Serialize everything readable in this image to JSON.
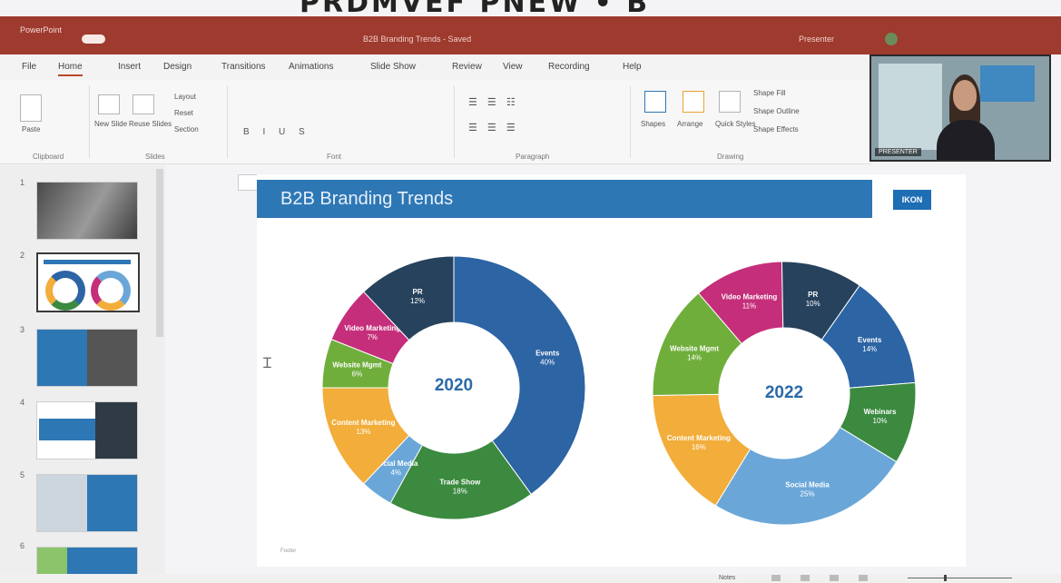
{
  "banner": {
    "text": "PRDMVEF PNEW • B"
  },
  "titlebar": {
    "app_name": "PowerPoint",
    "doc_title": "B2B Branding Trends - Saved",
    "user": "Presenter"
  },
  "menu": [
    "File",
    "Home",
    "Insert",
    "Design",
    "Transitions",
    "Animations",
    "Slide Show",
    "Review",
    "View",
    "Recording",
    "Help"
  ],
  "ribbon": {
    "paste": "Paste",
    "new_slide": "New Slide",
    "reuse": "Reuse Slides",
    "layout": "Layout",
    "reset": "Reset",
    "section": "Section",
    "shapes": "Shapes",
    "arrange": "Arrange",
    "quick_styles": "Quick Styles",
    "shape_fill": "Shape Fill",
    "shape_outline": "Shape Outline",
    "shape_effects": "Shape Effects",
    "groups": [
      "Clipboard",
      "Slides",
      "Font",
      "Paragraph",
      "Drawing"
    ]
  },
  "webcam": {
    "name": "PRESENTER"
  },
  "thumbnails": [
    "1",
    "2",
    "3",
    "4",
    "5",
    "6"
  ],
  "slide": {
    "title": "B2B Branding Trends",
    "logo": "IKON",
    "footer": "Footer",
    "chart_data": [
      {
        "type": "pie",
        "center_label": "2020",
        "slices": [
          {
            "label": "Events",
            "value": 40,
            "color": "#2c64a4"
          },
          {
            "label": "Trade Show",
            "value": 18,
            "color": "#3b8a3f"
          },
          {
            "label": "Social Media",
            "value": 4,
            "color": "#6aa7d8"
          },
          {
            "label": "Content Marketing",
            "value": 13,
            "color": "#f2ad3a"
          },
          {
            "label": "Website Mgmt",
            "value": 6,
            "color": "#6fae3b"
          },
          {
            "label": "Video Marketing",
            "value": 7,
            "color": "#c52e7a"
          },
          {
            "label": "PR",
            "value": 12,
            "color": "#27425c"
          }
        ]
      },
      {
        "type": "pie",
        "center_label": "2022",
        "slices": [
          {
            "label": "Events",
            "value": 14,
            "color": "#2c64a4"
          },
          {
            "label": "Webinars",
            "value": 10,
            "color": "#3b8a3f"
          },
          {
            "label": "Social Media",
            "value": 25,
            "color": "#6aa7d8"
          },
          {
            "label": "Content Marketing",
            "value": 16,
            "color": "#f2ad3a"
          },
          {
            "label": "Website Mgmt",
            "value": 14,
            "color": "#6fae3b"
          },
          {
            "label": "Video Marketing",
            "value": 11,
            "color": "#c52e7a"
          },
          {
            "label": "PR",
            "value": 10,
            "color": "#27425c"
          }
        ]
      }
    ]
  },
  "status": {
    "notes": "Notes"
  }
}
